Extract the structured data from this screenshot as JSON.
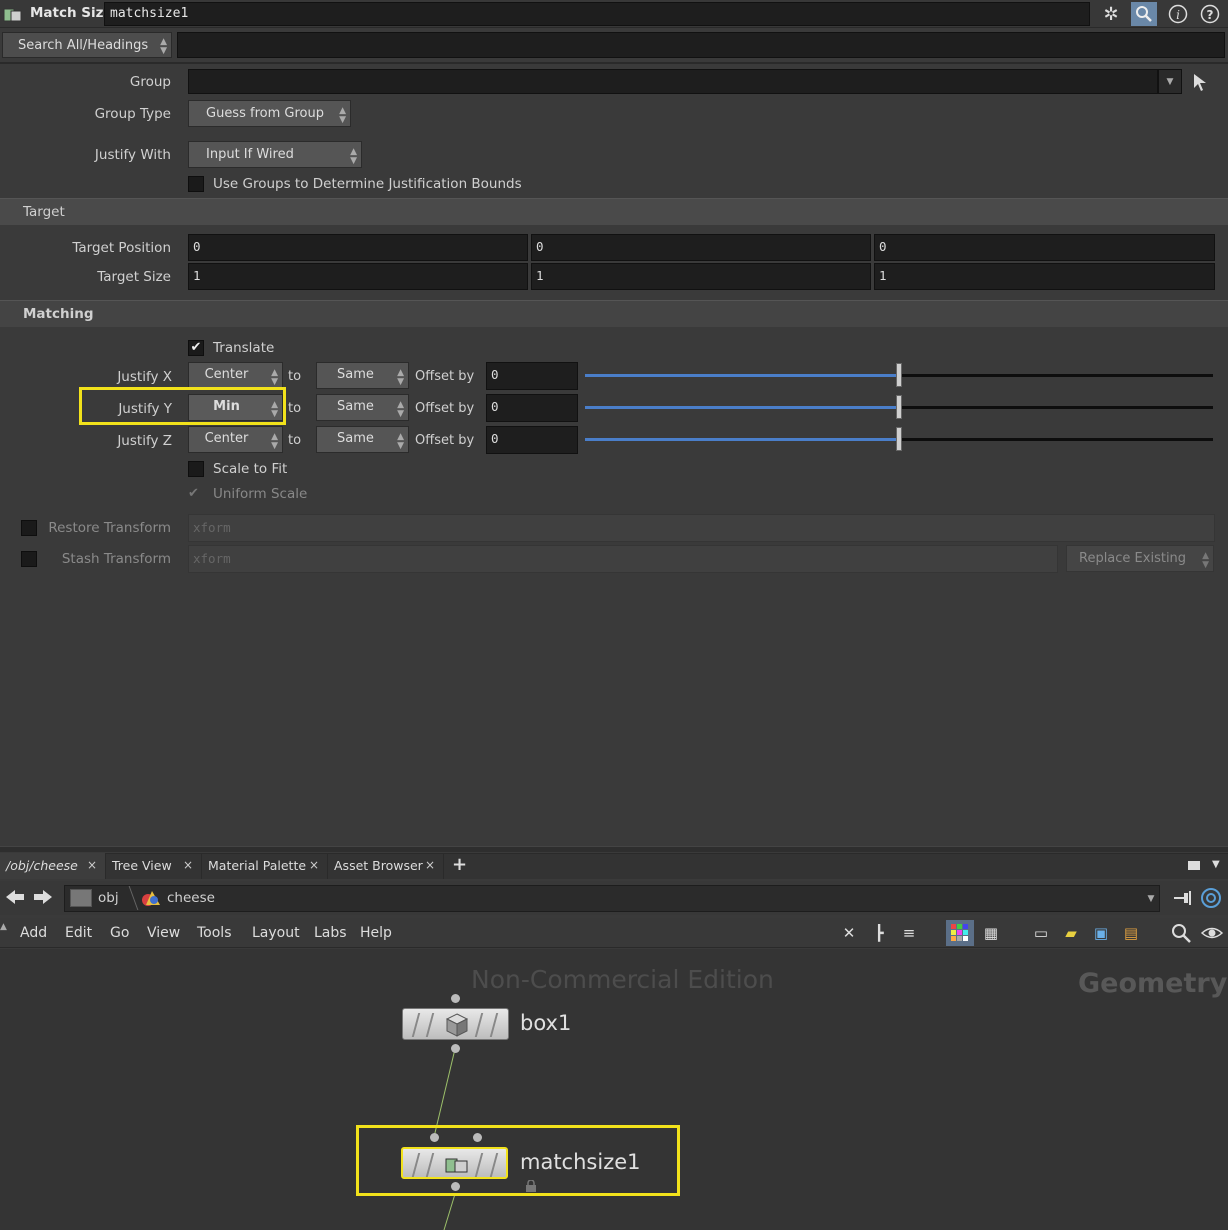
{
  "header": {
    "node_type": "Match Size",
    "node_name": "matchsize1",
    "icons": [
      "gear-icon",
      "search-icon",
      "info-icon",
      "help-icon"
    ]
  },
  "search": {
    "mode": "Search All/Headings",
    "value": ""
  },
  "params": {
    "group_label": "Group",
    "group_value": "",
    "group_type_label": "Group Type",
    "group_type_value": "Guess from Group",
    "justify_with_label": "Justify With",
    "justify_with_value": "Input If Wired",
    "use_groups_label": "Use Groups to Determine Justification Bounds",
    "use_groups_checked": false
  },
  "target": {
    "heading": "Target",
    "position_label": "Target Position",
    "position": [
      "0",
      "0",
      "0"
    ],
    "size_label": "Target Size",
    "size": [
      "1",
      "1",
      "1"
    ]
  },
  "matching": {
    "heading": "Matching",
    "translate_label": "Translate",
    "translate_checked": true,
    "to_label": "to",
    "offset_label": "Offset by",
    "rows": [
      {
        "label": "Justify X",
        "justify": "Center",
        "to": "Same",
        "offset": "0",
        "slider": 0.5
      },
      {
        "label": "Justify Y",
        "justify": "Min",
        "to": "Same",
        "offset": "0",
        "slider": 0.5
      },
      {
        "label": "Justify Z",
        "justify": "Center",
        "to": "Same",
        "offset": "0",
        "slider": 0.5
      }
    ],
    "scale_to_fit_label": "Scale to Fit",
    "uniform_scale_label": "Uniform Scale"
  },
  "transforms": {
    "restore_label": "Restore Transform",
    "restore_placeholder": "xform",
    "stash_label": "Stash Transform",
    "stash_placeholder": "xform",
    "stash_mode": "Replace Existing"
  },
  "network": {
    "tabs": [
      {
        "label": "/obj/cheese",
        "close": "×"
      },
      {
        "label": "Tree View",
        "close": "×"
      },
      {
        "label": "Material Palette",
        "close": "×"
      },
      {
        "label": "Asset Browser",
        "close": "×"
      }
    ],
    "add_tab": "+",
    "path": [
      "obj",
      "cheese"
    ],
    "menu": [
      "Add",
      "Edit",
      "Go",
      "View",
      "Tools",
      "Layout",
      "Labs",
      "Help"
    ],
    "watermark": "Non-Commercial Edition",
    "context": "Geometry",
    "nodes": [
      {
        "name": "box1"
      },
      {
        "name": "matchsize1"
      }
    ]
  },
  "colors": {
    "highlight": "#f2e21b",
    "slider_fill": "#4a7ec9"
  }
}
